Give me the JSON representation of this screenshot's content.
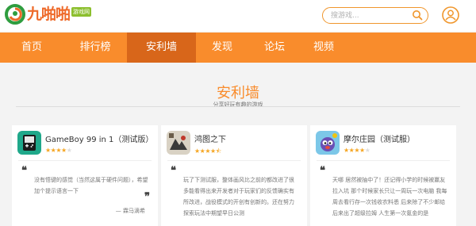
{
  "logo": {
    "text": "九啪啪",
    "badge": "游戏网"
  },
  "search": {
    "placeholder": "搜游戏..."
  },
  "nav": {
    "items": [
      {
        "label": "首页"
      },
      {
        "label": "排行榜"
      },
      {
        "label": "安利墙",
        "active": true
      },
      {
        "label": "发现"
      },
      {
        "label": "论坛"
      },
      {
        "label": "视频"
      }
    ]
  },
  "section": {
    "title": "安利墙",
    "subtitle": "分享好玩有趣的游戏"
  },
  "cards": [
    {
      "name": "GameBoy 99 in 1（测试版）",
      "rating": 4,
      "review": "没有悟键的感觉（当然这属于硬件问题），希望加个提示语言一下",
      "author": "— 霖马滴希"
    },
    {
      "name": "鸿图之下",
      "rating": 4.5,
      "review": "玩了下测试服，整体画风比之前的都改进了很多能看得出来开发者对于玩家们的反馈确实有所改进，战役模式的开创有创新的。还在努力探索玩法中期望早日公测",
      "author": ""
    },
    {
      "name": "摩尔庄园（测试服）",
      "rating": 4,
      "review": "天哪 居然被抽中了！还记得小学的时候被赢友拉入坑 那个时候家长只让一周玩一次电脑 我每周去看行存一次钱收农料悉 后来除了不少邮给后来出了超级拉姆 人生第一次氪金的是",
      "author": ""
    }
  ],
  "colors": {
    "accent": "#f98c2c",
    "nav_active": "#d8661a",
    "star": "#f5a623"
  }
}
